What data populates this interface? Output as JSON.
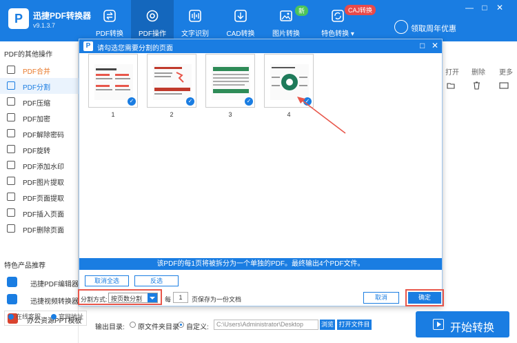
{
  "app": {
    "title": "迅捷PDF转换器",
    "version": "v9.1.3.7",
    "logo_letter": "P"
  },
  "nav": [
    {
      "label": "PDF转换",
      "icon": "convert-icon",
      "active": false
    },
    {
      "label": "PDF操作",
      "icon": "settings-gear-icon",
      "active": true
    },
    {
      "label": "文字识别",
      "icon": "ocr-icon",
      "active": false
    },
    {
      "label": "CAD转换",
      "icon": "cad-icon",
      "active": false
    },
    {
      "label": "图片转换",
      "icon": "image-icon",
      "active": false
    },
    {
      "label": "特色转换 ▾",
      "icon": "special-convert-icon",
      "active": false
    }
  ],
  "badges": {
    "new": "新",
    "caj": "CAJ转换"
  },
  "promo": {
    "label": "领取周年优惠"
  },
  "window_controls": [
    "—",
    "□",
    "✕"
  ],
  "sidebar": {
    "title": "PDF的其他操作",
    "items": [
      {
        "label": "PDF合并",
        "state": "highlight"
      },
      {
        "label": "PDF分割",
        "state": "selected"
      },
      {
        "label": "PDF压缩",
        "state": ""
      },
      {
        "label": "PDF加密",
        "state": ""
      },
      {
        "label": "PDF解除密码",
        "state": ""
      },
      {
        "label": "PDF旋转",
        "state": ""
      },
      {
        "label": "PDF添加水印",
        "state": ""
      },
      {
        "label": "PDF图片提取",
        "state": ""
      },
      {
        "label": "PDF页面提取",
        "state": ""
      },
      {
        "label": "PDF插入页面",
        "state": ""
      },
      {
        "label": "PDF删除页面",
        "state": ""
      }
    ],
    "recommend_title": "特色产品推荐",
    "recommend": [
      {
        "label": "迅捷PDF编辑器"
      },
      {
        "label": "迅捷视频转换器"
      },
      {
        "label": "办公资源PPT模板"
      }
    ],
    "footer": {
      "support": "在线客服",
      "website": "官网地址"
    }
  },
  "table_columns": {
    "open": "打开",
    "delete": "删除",
    "more": "更多"
  },
  "modal": {
    "title": "请勾选您需要分割的页面",
    "logo_letter": "P",
    "controls": [
      "□",
      "✕"
    ],
    "pages": [
      "1",
      "2",
      "3",
      "4"
    ],
    "check_mark": "✓",
    "info": "该PDF的每1页将被拆分为一个单独的PDF。最终输出4个PDF文件。",
    "deselect_all": "取消全选",
    "invert": "反选",
    "split_mode_label": "分割方式:",
    "split_mode_value": "按页数分割",
    "per_label": "每",
    "per_value": "1",
    "per_suffix": "页保存为一份文档",
    "cancel": "取消",
    "confirm": "确定"
  },
  "bottom": {
    "output_label": "输出目录:",
    "opt_source": "原文件夹目录",
    "opt_custom": "自定义:",
    "path": "C:\\Users\\Administrator\\Desktop",
    "browse": "浏览",
    "open_dir": "打开文件目录",
    "start": "开始转换"
  },
  "colors": {
    "brand": "#1a7de2",
    "highlight": "#e8792a",
    "annotation": "#e8564a"
  }
}
